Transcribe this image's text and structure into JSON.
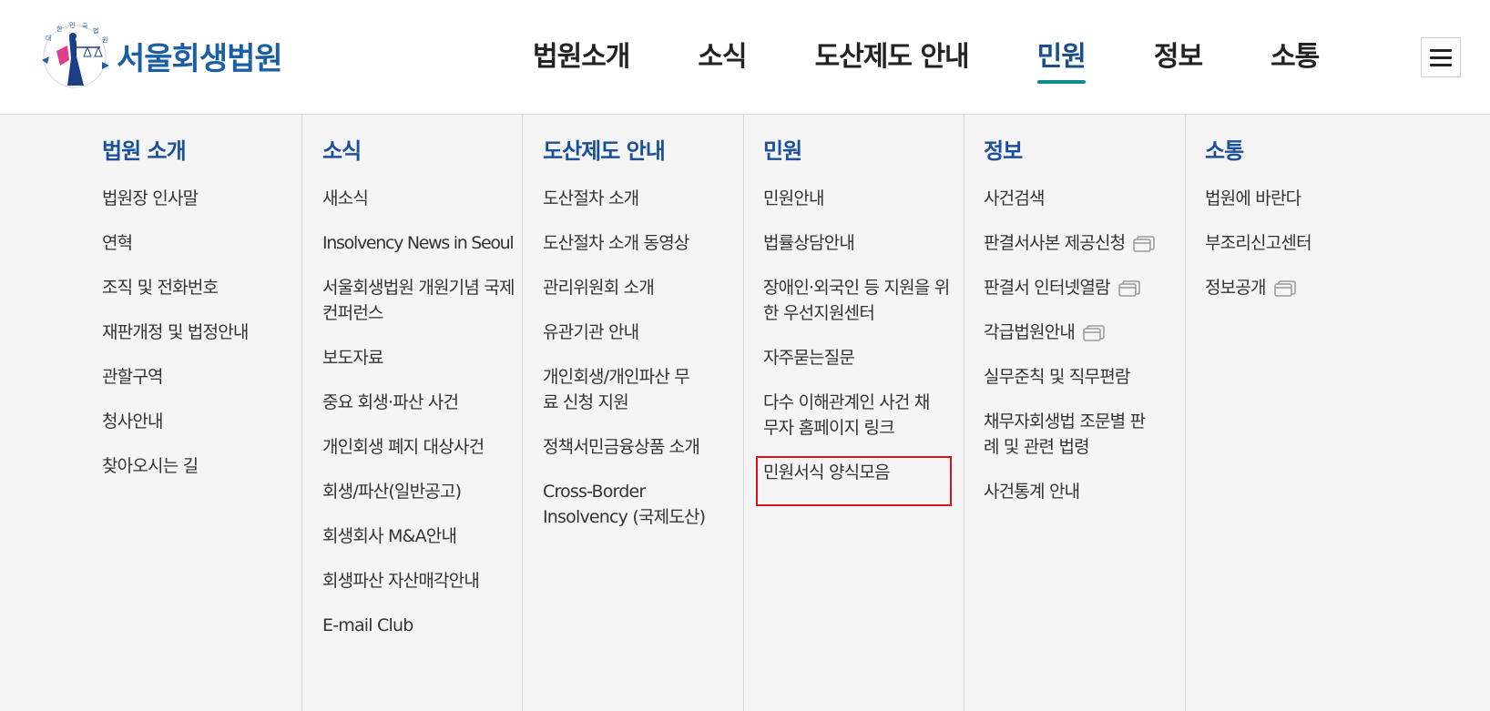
{
  "header": {
    "logo_text": "서울회생법원",
    "menu_icon": "hamburger-menu-icon",
    "nav": [
      {
        "label": "법원소개"
      },
      {
        "label": "소식"
      },
      {
        "label": "도산제도 안내"
      },
      {
        "label": "민원",
        "active": true
      },
      {
        "label": "정보"
      },
      {
        "label": "소통"
      }
    ]
  },
  "mega_menu": {
    "columns": [
      {
        "title": "법원 소개",
        "items": [
          {
            "label": "법원장 인사말"
          },
          {
            "label": "연혁"
          },
          {
            "label": "조직 및 전화번호"
          },
          {
            "label": "재판개정 및 법정안내"
          },
          {
            "label": "관할구역"
          },
          {
            "label": "청사안내"
          },
          {
            "label": "찾아오시는 길"
          }
        ]
      },
      {
        "title": "소식",
        "items": [
          {
            "label": "새소식"
          },
          {
            "label": "Insolvency News in Seoul"
          },
          {
            "label": "서울회생법원 개원기념 국제컨퍼런스"
          },
          {
            "label": "보도자료"
          },
          {
            "label": "중요 회생·파산 사건"
          },
          {
            "label": "개인회생 폐지 대상사건"
          },
          {
            "label": "회생/파산(일반공고)"
          },
          {
            "label": "회생회사 M&A안내"
          },
          {
            "label": "회생파산 자산매각안내"
          },
          {
            "label": "E-mail Club"
          }
        ]
      },
      {
        "title": "도산제도 안내",
        "items": [
          {
            "label": "도산절차 소개"
          },
          {
            "label": "도산절차 소개 동영상"
          },
          {
            "label": "관리위원회 소개"
          },
          {
            "label": "유관기관 안내"
          },
          {
            "label": "개인회생/개인파산 무료 신청 지원"
          },
          {
            "label": "정책서민금융상품 소개"
          },
          {
            "label": "Cross-Border Insolvency (국제도산)"
          }
        ]
      },
      {
        "title": "민원",
        "items": [
          {
            "label": "민원안내"
          },
          {
            "label": "법률상담안내"
          },
          {
            "label": "장애인·외국인 등 지원을 위한 우선지원센터"
          },
          {
            "label": "자주묻는질문"
          },
          {
            "label": "다수 이해관계인 사건 채무자 홈페이지 링크"
          },
          {
            "label": "민원서식 양식모음",
            "highlighted": true
          }
        ]
      },
      {
        "title": "정보",
        "items": [
          {
            "label": "사건검색"
          },
          {
            "label": "판결서사본 제공신청",
            "icon": "new-window-icon"
          },
          {
            "label": "판결서 인터넷열람",
            "icon": "new-window-icon"
          },
          {
            "label": "각급법원안내",
            "icon": "new-window-icon"
          },
          {
            "label": "실무준칙 및 직무편람"
          },
          {
            "label": "채무자회생법 조문별 판례 및 관련 법령"
          },
          {
            "label": "사건통계 안내"
          }
        ]
      },
      {
        "title": "소통",
        "items": [
          {
            "label": "법원에 바란다"
          },
          {
            "label": "부조리신고센터"
          },
          {
            "label": "정보공개",
            "icon": "new-window-icon"
          }
        ]
      }
    ]
  },
  "colors": {
    "brand": "#1b5fa3",
    "column_title": "#1a4f9c",
    "active_underline": "#0f8a8e",
    "highlight_border": "#d9121b",
    "menu_background": "#f5f5f5"
  }
}
